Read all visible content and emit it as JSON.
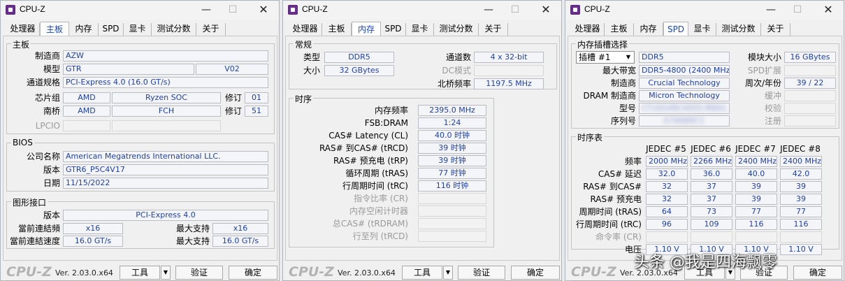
{
  "windows": [
    {
      "title": "CPU-Z",
      "tabs": [
        "处理器",
        "主板",
        "内存",
        "SPD",
        "显卡",
        "测试分数",
        "关于"
      ],
      "active_tab": "主板",
      "mainboard": {
        "group": "主板",
        "manufacturer_label": "制造商",
        "manufacturer": "AZW",
        "model_label": "模型",
        "model": "GTR",
        "model_rev": "V02",
        "bus_label": "通道规格",
        "bus": "PCI-Express 4.0 (16.0 GT/s)",
        "chipset_label": "芯片组",
        "chipset_vendor": "AMD",
        "chipset": "Ryzen SOC",
        "rev_label": "修订",
        "chipset_rev": "01",
        "southbridge_label": "南桥",
        "sb_vendor": "AMD",
        "sb": "FCH",
        "sb_rev": "51",
        "lpcio_label": "LPCIO"
      },
      "bios": {
        "group": "BIOS",
        "brand_label": "公司名称",
        "brand": "American Megatrends International LLC.",
        "version_label": "版本",
        "version": "GTR6_P5C4V17",
        "date_label": "日期",
        "date": "11/15/2022"
      },
      "graphic": {
        "group": "图形接口",
        "version_label": "版本",
        "version": "PCI-Express 4.0",
        "link_width_label": "當前連結頻",
        "link_width": "x16",
        "max_label": "最大支持",
        "max_width": "x16",
        "link_speed_label": "當前連結速度",
        "link_speed": "16.0 GT/s",
        "max_speed": "16.0 GT/s"
      }
    },
    {
      "title": "CPU-Z",
      "tabs": [
        "处理器",
        "主板",
        "内存",
        "SPD",
        "显卡",
        "测试分数",
        "关于"
      ],
      "active_tab": "内存",
      "general": {
        "group": "常规",
        "type_label": "类型",
        "type": "DDR5",
        "channel_label": "通道数",
        "channel": "4 x 32-bit",
        "size_label": "大小",
        "size": "32 GBytes",
        "dc_label": "DC模式",
        "nb_label": "北桥频率",
        "nb": "1197.5 MHz"
      },
      "timings": {
        "group": "时序",
        "rows": [
          {
            "label": "内存频率",
            "value": "2395.0 MHz",
            "enabled": true
          },
          {
            "label": "FSB:DRAM",
            "value": "1:24",
            "enabled": true
          },
          {
            "label": "CAS# Latency (CL)",
            "value": "40.0 时钟",
            "enabled": true
          },
          {
            "label": "RAS# 到CAS# (tRCD)",
            "value": "39 时钟",
            "enabled": true
          },
          {
            "label": "RAS# 预充电 (tRP)",
            "value": "39 时钟",
            "enabled": true
          },
          {
            "label": "循环周期 (tRAS)",
            "value": "77 时钟",
            "enabled": true
          },
          {
            "label": "行周期时间 (tRC)",
            "value": "116 时钟",
            "enabled": true
          },
          {
            "label": "指令比率 (CR)",
            "value": "",
            "enabled": false
          },
          {
            "label": "内存空闲计时器",
            "value": "",
            "enabled": false
          },
          {
            "label": "总CAS# (tRDRAM)",
            "value": "",
            "enabled": false
          },
          {
            "label": "行至列 (tRCD)",
            "value": "",
            "enabled": false
          }
        ]
      }
    },
    {
      "title": "CPU-Z",
      "tabs": [
        "处理器",
        "主板",
        "内存",
        "SPD",
        "显卡",
        "测试分数",
        "关于"
      ],
      "active_tab": "SPD",
      "slot": {
        "group": "内存插槽选择",
        "slot_select": "插槽 #1",
        "type": "DDR5",
        "module_size_label": "模块大小",
        "module_size": "16 GBytes",
        "max_bw_label": "最大带宽",
        "max_bw": "DDR5-4800 (2400 MHz)",
        "spd_ext_label": "SPD扩展",
        "manufacturer_label": "制造商",
        "manufacturer": "Crucial Technology",
        "week_label": "周次/年份",
        "week": "39 / 22",
        "dram_label": "DRAM 制造商",
        "dram": "Micron Technology",
        "buffered_label": "缓冲",
        "part_label": "型号",
        "part": "CT16G48C40S5.M8A1",
        "correction_label": "校验",
        "serial_label": "序列号",
        "serial": "E7A6B9C1",
        "registered_label": "注册"
      },
      "timing_table": {
        "group": "时序表",
        "headers": [
          "JEDEC #5",
          "JEDEC #6",
          "JEDEC #7",
          "JEDEC #8"
        ],
        "rows": [
          {
            "label": "频率",
            "values": [
              "2000 MHz",
              "2266 MHz",
              "2400 MHz",
              "2400 MHz"
            ],
            "enabled": true
          },
          {
            "label": "CAS# 延迟",
            "values": [
              "32.0",
              "36.0",
              "40.0",
              "42.0"
            ],
            "enabled": true
          },
          {
            "label": "RAS# 到CAS#",
            "values": [
              "32",
              "37",
              "39",
              "39"
            ],
            "enabled": true
          },
          {
            "label": "RAS# 预充电",
            "values": [
              "32",
              "37",
              "39",
              "39"
            ],
            "enabled": true
          },
          {
            "label": "周期时间 (tRAS)",
            "values": [
              "64",
              "73",
              "77",
              "77"
            ],
            "enabled": true
          },
          {
            "label": "行周期时间 (tRC)",
            "values": [
              "96",
              "109",
              "116",
              "116"
            ],
            "enabled": true
          },
          {
            "label": "命令率 (CR)",
            "values": [
              "",
              "",
              "",
              ""
            ],
            "enabled": false
          },
          {
            "label": "电压",
            "values": [
              "1.10 V",
              "1.10 V",
              "1.10 V",
              "1.10 V"
            ],
            "enabled": true
          }
        ]
      }
    }
  ],
  "footer": {
    "logo": "CPU-Z",
    "version": "Ver. 2.03.0.x64",
    "tools": "工具",
    "validate": "验证",
    "ok": "确定"
  },
  "watermark": "头条 @我是四海飘零"
}
